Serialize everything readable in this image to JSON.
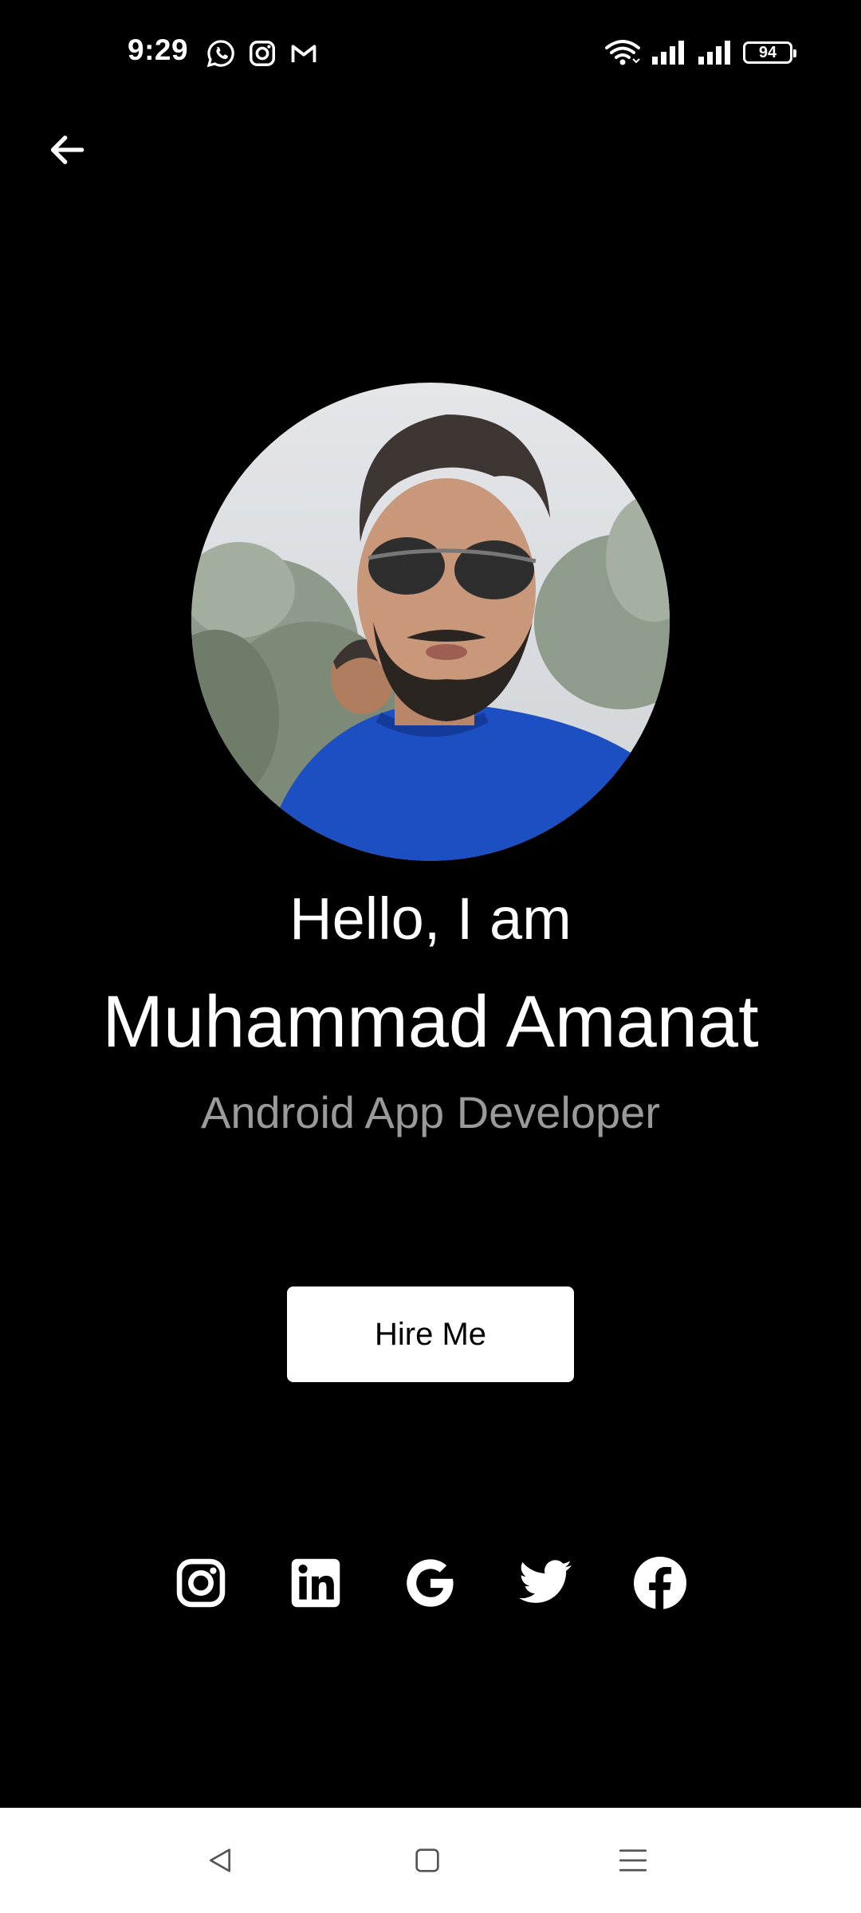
{
  "status_bar": {
    "time": "9:29",
    "battery_level": "94",
    "left_icons": [
      "whatsapp-icon",
      "instagram-icon",
      "gmail-icon"
    ],
    "right_icons": [
      "wifi-icon",
      "signal-icon",
      "signal-icon",
      "battery-icon"
    ]
  },
  "header": {
    "back_icon": "arrow-left-icon"
  },
  "profile": {
    "greeting": "Hello, I am",
    "name": "Muhammad Amanat",
    "role": "Android App Developer"
  },
  "actions": {
    "hire_label": "Hire Me"
  },
  "social_links": [
    {
      "name": "instagram-icon"
    },
    {
      "name": "linkedin-icon"
    },
    {
      "name": "google-icon"
    },
    {
      "name": "twitter-icon"
    },
    {
      "name": "facebook-icon"
    }
  ],
  "nav_bar": {
    "buttons": [
      "back-nav-icon",
      "home-nav-icon",
      "menu-nav-icon"
    ]
  },
  "colors": {
    "background": "#000000",
    "text_primary": "#ffffff",
    "text_secondary": "#9a9a9a",
    "button_bg": "#ffffff",
    "nav_bg": "#ffffff"
  }
}
